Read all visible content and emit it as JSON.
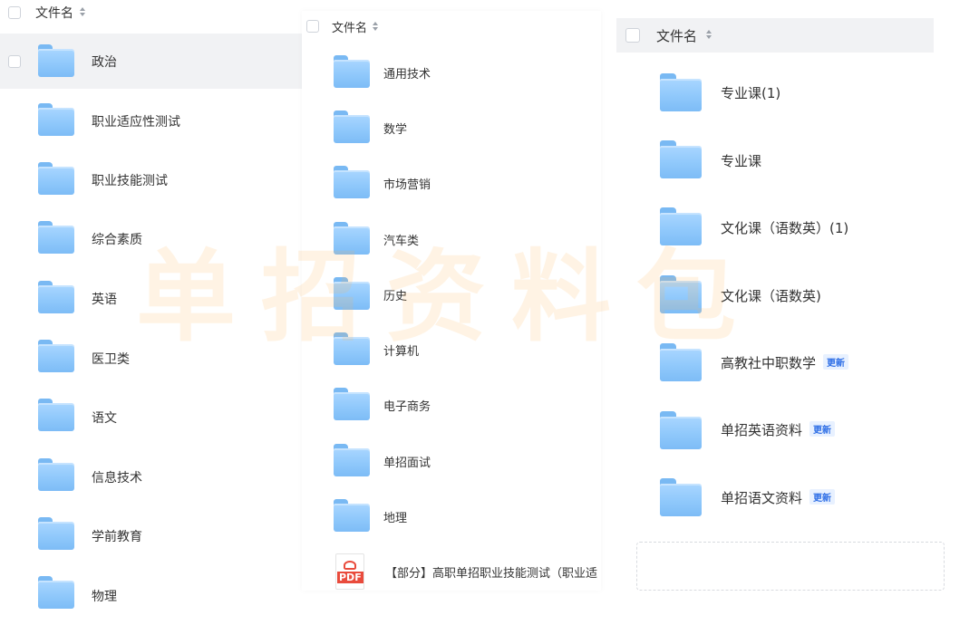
{
  "panels": [
    {
      "header": {
        "label": "文件名"
      },
      "items": [
        {
          "name": "政治"
        },
        {
          "name": "职业适应性测试"
        },
        {
          "name": "职业技能测试"
        },
        {
          "name": "综合素质"
        },
        {
          "name": "英语"
        },
        {
          "name": "医卫类"
        },
        {
          "name": "语文"
        },
        {
          "name": "信息技术"
        },
        {
          "name": "学前教育"
        },
        {
          "name": "物理"
        }
      ]
    },
    {
      "header": {
        "label": "文件名"
      },
      "items": [
        {
          "name": "通用技术"
        },
        {
          "name": "数学"
        },
        {
          "name": "市场营销"
        },
        {
          "name": "汽车类"
        },
        {
          "name": "历史"
        },
        {
          "name": "计算机"
        },
        {
          "name": "电子商务"
        },
        {
          "name": "单招面试"
        },
        {
          "name": "地理"
        },
        {
          "name": "【部分】高职单招职业技能测试（职业适",
          "pdf_icon_text": "PDF"
        }
      ]
    },
    {
      "header": {
        "label": "文件名"
      },
      "items": [
        {
          "name": "专业课(1)"
        },
        {
          "name": "专业课"
        },
        {
          "name": "文化课（语数英）(1)"
        },
        {
          "name": "文化课（语数英)"
        },
        {
          "name": "高教社中职数学",
          "badge": "更新"
        },
        {
          "name": "单招英语资料",
          "badge": "更新"
        },
        {
          "name": "单招语文资料",
          "badge": "更新"
        }
      ]
    }
  ],
  "watermark": "单招资料包",
  "colors": {
    "folder": "#8fc8fb",
    "badge_text": "#2f6fe6",
    "badge_bg": "#e8f1ff",
    "selected_row": "#f1f2f4",
    "watermark": "#fcb45a"
  }
}
